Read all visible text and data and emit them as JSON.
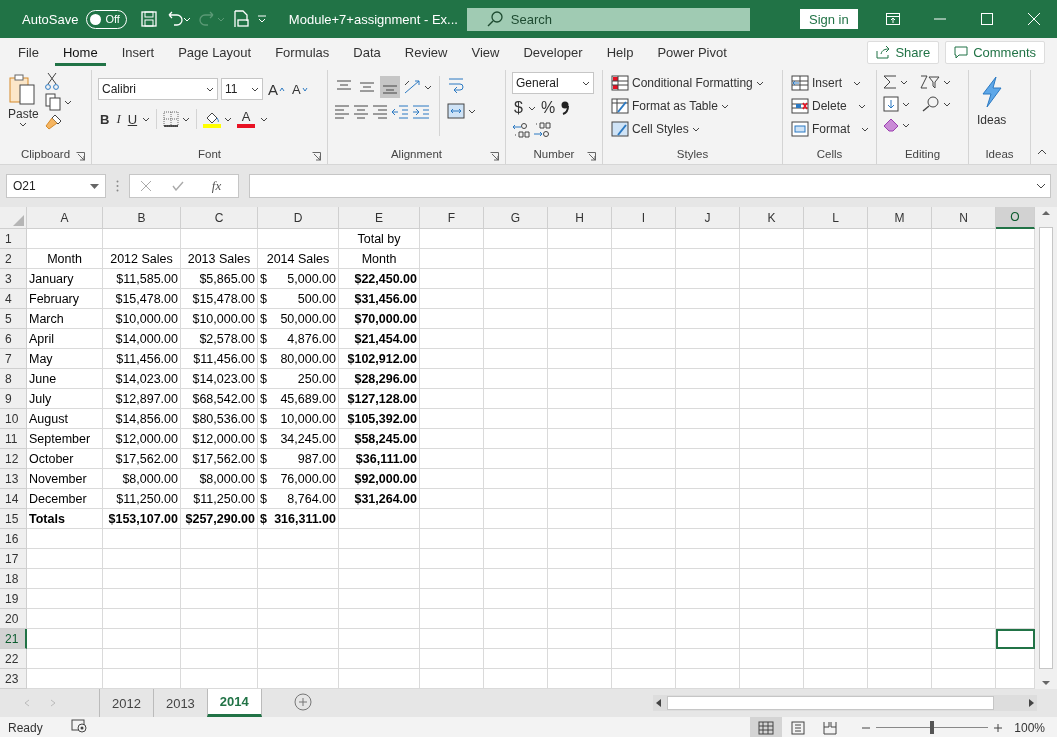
{
  "title_bar": {
    "autosave_label": "AutoSave",
    "autosave_toggle": {
      "label": "Off",
      "on": false
    },
    "file_name": "Module+7+assignment  -  Ex...",
    "search_placeholder": "Search",
    "sign_in": "Sign in"
  },
  "menu_tabs": [
    {
      "label": "File",
      "selected": false
    },
    {
      "label": "Home",
      "selected": true
    },
    {
      "label": "Insert",
      "selected": false
    },
    {
      "label": "Page Layout",
      "selected": false
    },
    {
      "label": "Formulas",
      "selected": false
    },
    {
      "label": "Data",
      "selected": false
    },
    {
      "label": "Review",
      "selected": false
    },
    {
      "label": "View",
      "selected": false
    },
    {
      "label": "Developer",
      "selected": false
    },
    {
      "label": "Help",
      "selected": false
    },
    {
      "label": "Power Pivot",
      "selected": false
    }
  ],
  "share": "Share",
  "comments": "Comments",
  "ribbon": {
    "clipboard": {
      "paste": "Paste",
      "label": "Clipboard"
    },
    "font": {
      "name": "Calibri",
      "size": "11",
      "grow": "A",
      "shrink": "A",
      "bold": "B",
      "italic": "I",
      "underline": "U",
      "font_color_letter": "A",
      "label": "Font"
    },
    "alignment": {
      "vertical": [
        {
          "kind": "top",
          "selected": false
        },
        {
          "kind": "middle",
          "selected": false
        },
        {
          "kind": "bottom",
          "selected": true
        }
      ],
      "label": "Alignment"
    },
    "number": {
      "format": "General",
      "currency": "$",
      "percent": "%",
      "label": "Number"
    },
    "styles": {
      "items": [
        "Conditional Formatting",
        "Format as Table",
        "Cell Styles"
      ],
      "label": "Styles"
    },
    "cells": {
      "items": [
        "Insert",
        "Delete",
        "Format"
      ],
      "label": "Cells"
    },
    "editing": {
      "label": "Editing"
    },
    "ideas": {
      "button": "Ideas",
      "label": "Ideas"
    }
  },
  "formula_bar": {
    "name_box": "O21",
    "fx": "fx"
  },
  "columns": [
    {
      "label": "A",
      "selected": false
    },
    {
      "label": "B",
      "selected": false
    },
    {
      "label": "C",
      "selected": false
    },
    {
      "label": "D",
      "selected": false
    },
    {
      "label": "E",
      "selected": false
    },
    {
      "label": "F",
      "selected": false
    },
    {
      "label": "G",
      "selected": false
    },
    {
      "label": "H",
      "selected": false
    },
    {
      "label": "I",
      "selected": false
    },
    {
      "label": "J",
      "selected": false
    },
    {
      "label": "K",
      "selected": false
    },
    {
      "label": "L",
      "selected": false
    },
    {
      "label": "M",
      "selected": false
    },
    {
      "label": "N",
      "selected": false
    },
    {
      "label": "O",
      "selected": true
    }
  ],
  "rows": [
    {
      "number": "1",
      "selected": false,
      "cells": [
        null,
        null,
        null,
        null,
        {
          "kind": "header",
          "text": "Total by",
          "bold": false
        }
      ]
    },
    {
      "number": "2",
      "selected": false,
      "cells": [
        {
          "kind": "header",
          "text": "Month",
          "bold": false
        },
        {
          "kind": "header",
          "text": "2012 Sales",
          "bold": false
        },
        {
          "kind": "header",
          "text": "2013 Sales",
          "bold": false
        },
        {
          "kind": "header",
          "text": "2014 Sales",
          "bold": false
        },
        {
          "kind": "header",
          "text": "Month",
          "bold": false
        }
      ]
    },
    {
      "number": "3",
      "selected": false,
      "cells": [
        {
          "kind": "text",
          "text": "January",
          "bold": false
        },
        {
          "kind": "number",
          "text": "$11,585.00",
          "bold": false
        },
        {
          "kind": "number",
          "text": "$5,865.00",
          "bold": false
        },
        {
          "kind": "accounting",
          "symbol": "$",
          "amount": "5,000.00",
          "bold": false
        },
        {
          "kind": "number",
          "text": "$22,450.00",
          "bold": true
        }
      ]
    },
    {
      "number": "4",
      "selected": false,
      "cells": [
        {
          "kind": "text",
          "text": "February",
          "bold": false
        },
        {
          "kind": "number",
          "text": "$15,478.00",
          "bold": false
        },
        {
          "kind": "number",
          "text": "$15,478.00",
          "bold": false
        },
        {
          "kind": "accounting",
          "symbol": "$",
          "amount": "500.00",
          "bold": false
        },
        {
          "kind": "number",
          "text": "$31,456.00",
          "bold": true
        }
      ]
    },
    {
      "number": "5",
      "selected": false,
      "cells": [
        {
          "kind": "text",
          "text": "March",
          "bold": false
        },
        {
          "kind": "number",
          "text": "$10,000.00",
          "bold": false
        },
        {
          "kind": "number",
          "text": "$10,000.00",
          "bold": false
        },
        {
          "kind": "accounting",
          "symbol": "$",
          "amount": "50,000.00",
          "bold": false
        },
        {
          "kind": "number",
          "text": "$70,000.00",
          "bold": true
        }
      ]
    },
    {
      "number": "6",
      "selected": false,
      "cells": [
        {
          "kind": "text",
          "text": "April",
          "bold": false
        },
        {
          "kind": "number",
          "text": "$14,000.00",
          "bold": false
        },
        {
          "kind": "number",
          "text": "$2,578.00",
          "bold": false
        },
        {
          "kind": "accounting",
          "symbol": "$",
          "amount": "4,876.00",
          "bold": false
        },
        {
          "kind": "number",
          "text": "$21,454.00",
          "bold": true
        }
      ]
    },
    {
      "number": "7",
      "selected": false,
      "cells": [
        {
          "kind": "text",
          "text": "May",
          "bold": false
        },
        {
          "kind": "number",
          "text": "$11,456.00",
          "bold": false
        },
        {
          "kind": "number",
          "text": "$11,456.00",
          "bold": false
        },
        {
          "kind": "accounting",
          "symbol": "$",
          "amount": "80,000.00",
          "bold": false
        },
        {
          "kind": "number",
          "text": "$102,912.00",
          "bold": true
        }
      ]
    },
    {
      "number": "8",
      "selected": false,
      "cells": [
        {
          "kind": "text",
          "text": "June",
          "bold": false
        },
        {
          "kind": "number",
          "text": "$14,023.00",
          "bold": false
        },
        {
          "kind": "number",
          "text": "$14,023.00",
          "bold": false
        },
        {
          "kind": "accounting",
          "symbol": "$",
          "amount": "250.00",
          "bold": false
        },
        {
          "kind": "number",
          "text": "$28,296.00",
          "bold": true
        }
      ]
    },
    {
      "number": "9",
      "selected": false,
      "cells": [
        {
          "kind": "text",
          "text": "July",
          "bold": false
        },
        {
          "kind": "number",
          "text": "$12,897.00",
          "bold": false
        },
        {
          "kind": "number",
          "text": "$68,542.00",
          "bold": false
        },
        {
          "kind": "accounting",
          "symbol": "$",
          "amount": "45,689.00",
          "bold": false
        },
        {
          "kind": "number",
          "text": "$127,128.00",
          "bold": true
        }
      ]
    },
    {
      "number": "10",
      "selected": false,
      "cells": [
        {
          "kind": "text",
          "text": "August",
          "bold": false
        },
        {
          "kind": "number",
          "text": "$14,856.00",
          "bold": false
        },
        {
          "kind": "number",
          "text": "$80,536.00",
          "bold": false
        },
        {
          "kind": "accounting",
          "symbol": "$",
          "amount": "10,000.00",
          "bold": false
        },
        {
          "kind": "number",
          "text": "$105,392.00",
          "bold": true
        }
      ]
    },
    {
      "number": "11",
      "selected": false,
      "cells": [
        {
          "kind": "text",
          "text": "September",
          "bold": false
        },
        {
          "kind": "number",
          "text": "$12,000.00",
          "bold": false
        },
        {
          "kind": "number",
          "text": "$12,000.00",
          "bold": false
        },
        {
          "kind": "accounting",
          "symbol": "$",
          "amount": "34,245.00",
          "bold": false
        },
        {
          "kind": "number",
          "text": "$58,245.00",
          "bold": true
        }
      ]
    },
    {
      "number": "12",
      "selected": false,
      "cells": [
        {
          "kind": "text",
          "text": "October",
          "bold": false
        },
        {
          "kind": "number",
          "text": "$17,562.00",
          "bold": false
        },
        {
          "kind": "number",
          "text": "$17,562.00",
          "bold": false
        },
        {
          "kind": "accounting",
          "symbol": "$",
          "amount": "987.00",
          "bold": false
        },
        {
          "kind": "number",
          "text": "$36,111.00",
          "bold": true
        }
      ]
    },
    {
      "number": "13",
      "selected": false,
      "cells": [
        {
          "kind": "text",
          "text": "November",
          "bold": false
        },
        {
          "kind": "number",
          "text": "$8,000.00",
          "bold": false
        },
        {
          "kind": "number",
          "text": "$8,000.00",
          "bold": false
        },
        {
          "kind": "accounting",
          "symbol": "$",
          "amount": "76,000.00",
          "bold": false
        },
        {
          "kind": "number",
          "text": "$92,000.00",
          "bold": true
        }
      ]
    },
    {
      "number": "14",
      "selected": false,
      "cells": [
        {
          "kind": "text",
          "text": "December",
          "bold": false
        },
        {
          "kind": "number",
          "text": "$11,250.00",
          "bold": false
        },
        {
          "kind": "number",
          "text": "$11,250.00",
          "bold": false
        },
        {
          "kind": "accounting",
          "symbol": "$",
          "amount": "8,764.00",
          "bold": false
        },
        {
          "kind": "number",
          "text": "$31,264.00",
          "bold": true
        }
      ]
    },
    {
      "number": "15",
      "selected": false,
      "cells": [
        {
          "kind": "text",
          "text": "Totals",
          "bold": true
        },
        {
          "kind": "number",
          "text": "$153,107.00",
          "bold": true
        },
        {
          "kind": "number",
          "text": "$257,290.00",
          "bold": true
        },
        {
          "kind": "accounting",
          "symbol": "$",
          "amount": "316,311.00",
          "bold": true
        },
        null
      ]
    },
    {
      "number": "16",
      "selected": false
    },
    {
      "number": "17",
      "selected": false
    },
    {
      "number": "18",
      "selected": false
    },
    {
      "number": "19",
      "selected": false
    },
    {
      "number": "20",
      "selected": false
    },
    {
      "number": "21",
      "selected": true
    },
    {
      "number": "22",
      "selected": false
    },
    {
      "number": "23",
      "selected": false
    }
  ],
  "sheet_tabs": [
    {
      "label": "2012",
      "selected": false
    },
    {
      "label": "2013",
      "selected": false
    },
    {
      "label": "2014",
      "selected": true
    }
  ],
  "status_bar": {
    "status": "Ready",
    "views": [
      {
        "kind": "normal",
        "selected": true
      },
      {
        "kind": "page-layout",
        "selected": false
      },
      {
        "kind": "page-break",
        "selected": false
      }
    ],
    "zoom": {
      "level": 0.5,
      "label": "100%"
    }
  }
}
